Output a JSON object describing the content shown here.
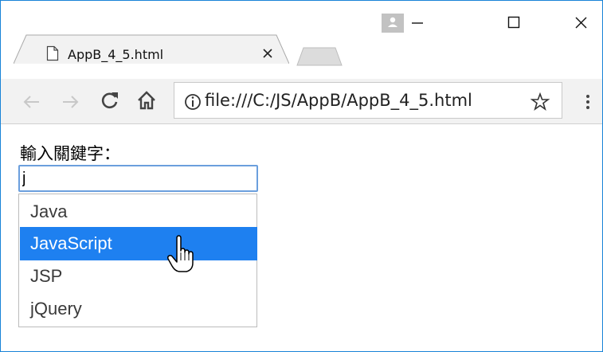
{
  "browser": {
    "tab_title": "AppB_4_5.html",
    "url": "file:///C:/JS/AppB/AppB_4_5.html",
    "colors": {
      "window_border": "#1883d7",
      "toolbar_bg": "#f2f2f2",
      "selection": "#1e80f0"
    }
  },
  "page": {
    "label": "輸入關鍵字：",
    "input_value": "j",
    "suggestions": [
      "Java",
      "JavaScript",
      "JSP",
      "jQuery"
    ],
    "selected_suggestion": "JavaScript"
  },
  "icons": {
    "profile": "profile-icon",
    "minimize": "minimize-icon",
    "maximize": "maximize-icon",
    "close": "close-icon",
    "back": "back-icon",
    "forward": "forward-icon",
    "reload": "reload-icon",
    "home": "home-icon",
    "info": "info-icon",
    "star": "star-icon",
    "menu": "menu-icon",
    "cursor": "hand-cursor-icon"
  }
}
